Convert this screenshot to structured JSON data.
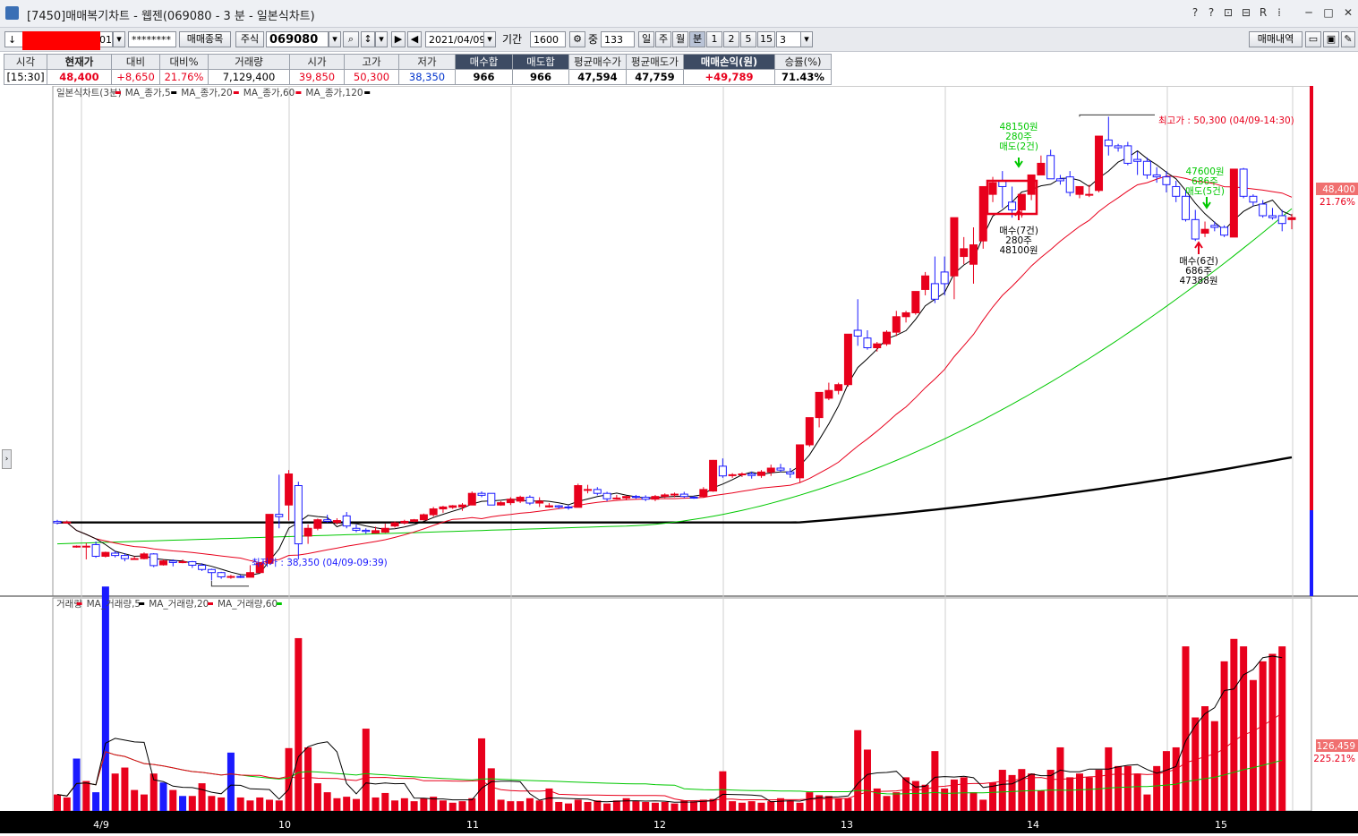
{
  "window": {
    "title": "[7450]매매복기차트 - 웹젠(069080 - 3 분 - 일본식차트)",
    "controls": [
      "?",
      "?",
      "⊡",
      "⊟",
      "R",
      "⁞",
      "─",
      "□",
      "✕"
    ]
  },
  "toolbar": {
    "account_prefix": "↓",
    "account_suffix": "01",
    "password": "********",
    "trade_item_label": "매매종목",
    "market_label": "주식",
    "code": "069080",
    "date": "2021/04/09",
    "period_label": "기간",
    "period_value": "1600",
    "count_label": "중",
    "count_value": "133",
    "interval_buttons": [
      "일",
      "주",
      "월",
      "분",
      "1",
      "2",
      "5",
      "15"
    ],
    "selected_interval": "분",
    "minute_value": "3",
    "trade_history_label": "매매내역"
  },
  "quote": {
    "headers": [
      "시각",
      "현재가",
      "대비",
      "대비%",
      "거래량",
      "시가",
      "고가",
      "저가",
      "매수합",
      "매도합",
      "평균매수가",
      "평균매도가",
      "매매손익(원)",
      "승률(%)"
    ],
    "values": [
      "[15:30]",
      "48,400",
      "+8,650",
      "21.76%",
      "7,129,400",
      "39,850",
      "50,300",
      "38,350",
      "966",
      "966",
      "47,594",
      "47,759",
      "+49,789",
      "71.43%"
    ]
  },
  "price_panel": {
    "legend": [
      {
        "label": "일본식차트(3분)",
        "color": "#e8001c"
      },
      {
        "label": "MA_종가,5",
        "color": "#000000"
      },
      {
        "label": "MA_종가,20",
        "color": "#e8001c"
      },
      {
        "label": "MA_종가,60",
        "color": "#e8001c"
      },
      {
        "label": "MA_종가,120",
        "color": "#000000"
      }
    ],
    "current_price_label": "48,400",
    "current_pct_label": "21.76%",
    "high_annotation": "최고가 : 50,300 (04/09-14:30)",
    "low_annotation": "최저가 : 38,350 (04/09-09:39)",
    "sell1": [
      "48150원",
      "280주",
      "매도(2건)"
    ],
    "buy1": [
      "매수(7건)",
      "280주",
      "48100원"
    ],
    "sell2": [
      "47600원",
      "686주",
      "매도(5건)"
    ],
    "buy2": [
      "매수(6건)",
      "686주",
      "47388원"
    ]
  },
  "volume_panel": {
    "legend": [
      {
        "label": "거래량",
        "color": "#e8001c"
      },
      {
        "label": "MA_거래량,5",
        "color": "#000000"
      },
      {
        "label": "MA_거래량,20",
        "color": "#e8001c"
      },
      {
        "label": "MA_거래량,60",
        "color": "#00c800"
      }
    ],
    "current_label": "126,459",
    "current_pct_label": "225.21%"
  },
  "x_axis": [
    "4/9",
    "10",
    "11",
    "12",
    "13",
    "14",
    "15"
  ],
  "colors": {
    "up": "#e8001c",
    "down": "#1a1aff",
    "ma5": "#000000",
    "ma20": "#e8001c",
    "ma60": "#00c800",
    "ma120": "#000000"
  },
  "chart_data": {
    "type": "candlestick",
    "interval": "3분",
    "y_range": [
      38000,
      51000
    ],
    "x_ticks": [
      "4/9",
      "10",
      "11",
      "12",
      "13",
      "14",
      "15"
    ],
    "candles": [
      [
        39880,
        39920,
        39800,
        39840
      ],
      [
        39840,
        39900,
        39820,
        39860
      ],
      [
        39240,
        39260,
        39200,
        39240
      ],
      [
        39240,
        39320,
        38900,
        39240
      ],
      [
        39280,
        39360,
        38940,
        38980
      ],
      [
        38980,
        39100,
        38950,
        39080
      ],
      [
        39060,
        39120,
        38950,
        39000
      ],
      [
        39000,
        39060,
        38850,
        38920
      ],
      [
        38920,
        38980,
        38900,
        38920
      ],
      [
        38920,
        39080,
        38900,
        39040
      ],
      [
        39040,
        39060,
        38700,
        38740
      ],
      [
        38760,
        38900,
        38740,
        38860
      ],
      [
        38860,
        38900,
        38720,
        38820
      ],
      [
        38820,
        38900,
        38800,
        38840
      ],
      [
        38840,
        38860,
        38680,
        38750
      ],
      [
        38750,
        38800,
        38600,
        38640
      ],
      [
        38640,
        38660,
        38360,
        38560
      ],
      [
        38560,
        38580,
        38400,
        38450
      ],
      [
        38450,
        38500,
        38400,
        38460
      ],
      [
        38460,
        38500,
        38420,
        38440
      ],
      [
        38440,
        38750,
        38440,
        38560
      ],
      [
        38560,
        38820,
        38550,
        38800
      ],
      [
        38800,
        40060,
        38780,
        40060
      ],
      [
        40060,
        41080,
        39700,
        40000
      ],
      [
        40300,
        41200,
        39900,
        41100
      ],
      [
        40800,
        40900,
        38900,
        39300
      ],
      [
        39500,
        39800,
        39300,
        39700
      ],
      [
        39700,
        39950,
        39650,
        39920
      ],
      [
        39920,
        40050,
        39850,
        39880
      ],
      [
        39850,
        39960,
        39800,
        39900
      ],
      [
        40020,
        40120,
        39700,
        39760
      ],
      [
        39700,
        39800,
        39600,
        39650
      ],
      [
        39650,
        39700,
        39560,
        39620
      ],
      [
        39580,
        39740,
        39560,
        39640
      ],
      [
        39600,
        39820,
        39580,
        39700
      ],
      [
        39760,
        39880,
        39720,
        39840
      ],
      [
        39840,
        39920,
        39800,
        39880
      ],
      [
        39880,
        39940,
        39860,
        39920
      ],
      [
        39920,
        40080,
        39900,
        40050
      ],
      [
        40050,
        40250,
        40000,
        40200
      ],
      [
        40200,
        40280,
        40100,
        40250
      ],
      [
        40240,
        40300,
        40200,
        40280
      ],
      [
        40250,
        40350,
        40150,
        40300
      ],
      [
        40300,
        40650,
        40300,
        40600
      ],
      [
        40600,
        40650,
        40500,
        40550
      ],
      [
        40600,
        40580,
        40300,
        40300
      ],
      [
        40300,
        40400,
        40280,
        40360
      ],
      [
        40360,
        40500,
        40300,
        40450
      ],
      [
        40400,
        40540,
        40350,
        40500
      ],
      [
        40500,
        40550,
        40300,
        40350
      ],
      [
        40350,
        40500,
        40250,
        40400
      ],
      [
        40250,
        40350,
        40230,
        40280
      ],
      [
        40280,
        40300,
        40200,
        40250
      ],
      [
        40250,
        40300,
        40180,
        40240
      ],
      [
        40240,
        40850,
        40240,
        40800
      ],
      [
        40680,
        40820,
        40600,
        40700
      ],
      [
        40700,
        40760,
        40550,
        40600
      ],
      [
        40600,
        40640,
        40400,
        40460
      ],
      [
        40460,
        40560,
        40440,
        40480
      ],
      [
        40480,
        40540,
        40420,
        40520
      ],
      [
        40520,
        40560,
        40460,
        40500
      ],
      [
        40500,
        40550,
        40400,
        40450
      ],
      [
        40450,
        40560,
        40400,
        40520
      ],
      [
        40520,
        40600,
        40480,
        40560
      ],
      [
        40560,
        40620,
        40500,
        40580
      ],
      [
        40580,
        40640,
        40480,
        40520
      ],
      [
        40500,
        40540,
        40460,
        40480
      ],
      [
        40520,
        40760,
        40500,
        40700
      ],
      [
        40660,
        41460,
        40640,
        41450
      ],
      [
        41300,
        41500,
        41000,
        41050
      ],
      [
        41060,
        41120,
        41000,
        41080
      ],
      [
        41080,
        41140,
        41020,
        41100
      ],
      [
        41100,
        41160,
        40980,
        41060
      ],
      [
        41060,
        41200,
        41000,
        41150
      ],
      [
        41150,
        41340,
        41050,
        41250
      ],
      [
        41250,
        41360,
        41150,
        41200
      ],
      [
        41150,
        41250,
        41000,
        41100
      ],
      [
        41000,
        41850,
        40880,
        41850
      ],
      [
        41850,
        42550,
        41800,
        42550
      ],
      [
        42550,
        43200,
        42300,
        43200
      ],
      [
        43050,
        43450,
        43000,
        43250
      ],
      [
        43250,
        43450,
        43150,
        43400
      ],
      [
        43400,
        44700,
        43350,
        44700
      ],
      [
        44800,
        45600,
        44400,
        44650
      ],
      [
        44600,
        44800,
        44300,
        44350
      ],
      [
        44350,
        44500,
        44250,
        44450
      ],
      [
        44450,
        44800,
        44400,
        44750
      ],
      [
        44750,
        45300,
        44650,
        45150
      ],
      [
        45150,
        45300,
        45000,
        45250
      ],
      [
        45250,
        45800,
        45200,
        45800
      ],
      [
        45850,
        46300,
        45700,
        46200
      ],
      [
        46000,
        46700,
        45500,
        45600
      ],
      [
        46300,
        46700,
        45700,
        46000
      ],
      [
        46200,
        47700,
        45600,
        47700
      ],
      [
        46700,
        47200,
        46500,
        46900
      ],
      [
        46500,
        47450,
        46000,
        47000
      ],
      [
        47100,
        48500,
        46900,
        48500
      ],
      [
        48300,
        48750,
        48100,
        48600
      ],
      [
        48650,
        48900,
        47950,
        48500
      ],
      [
        48100,
        48500,
        47700,
        47900
      ],
      [
        47900,
        48300,
        47700,
        48300
      ],
      [
        48300,
        48800,
        48150,
        48800
      ],
      [
        48800,
        49300,
        48900,
        49100
      ],
      [
        49300,
        49450,
        48700,
        48700
      ],
      [
        48700,
        48800,
        48550,
        48650
      ],
      [
        48750,
        48900,
        48250,
        48350
      ],
      [
        48300,
        48500,
        48200,
        48500
      ],
      [
        48300,
        48550,
        48230,
        48300
      ],
      [
        48400,
        49800,
        48350,
        49800
      ],
      [
        49700,
        50300,
        49300,
        49550
      ],
      [
        49550,
        49600,
        49400,
        49500
      ],
      [
        49550,
        49650,
        49050,
        49100
      ],
      [
        49200,
        49400,
        48800,
        49150
      ],
      [
        49150,
        49250,
        48700,
        48800
      ],
      [
        48800,
        49000,
        48600,
        48750
      ],
      [
        48750,
        48900,
        48350,
        48550
      ],
      [
        48500,
        48650,
        48100,
        48250
      ],
      [
        48250,
        48400,
        47600,
        47650
      ],
      [
        47650,
        47900,
        47100,
        47150
      ],
      [
        47300,
        47600,
        47200,
        47400
      ],
      [
        47500,
        47600,
        47350,
        47450
      ],
      [
        47450,
        47500,
        47200,
        47250
      ],
      [
        47200,
        48950,
        47200,
        48950
      ],
      [
        48950,
        48980,
        48200,
        48250
      ],
      [
        48250,
        48300,
        48000,
        48100
      ],
      [
        48050,
        48150,
        47700,
        47750
      ],
      [
        47750,
        47950,
        47650,
        47700
      ],
      [
        47750,
        47900,
        47350,
        47550
      ],
      [
        47650,
        47800,
        47400,
        47700
      ]
    ],
    "volume_y_range": [
      0,
      280000
    ],
    "volume": [
      [
        2200,
        1
      ],
      [
        1800,
        1
      ],
      [
        7000,
        0
      ],
      [
        4000,
        1
      ],
      [
        2500,
        0
      ],
      [
        30000,
        0
      ],
      [
        5000,
        1
      ],
      [
        5800,
        1
      ],
      [
        2800,
        1
      ],
      [
        2200,
        1
      ],
      [
        5000,
        1
      ],
      [
        3800,
        0
      ],
      [
        2800,
        1
      ],
      [
        2000,
        0
      ],
      [
        2000,
        1
      ],
      [
        3700,
        1
      ],
      [
        2000,
        1
      ],
      [
        1800,
        1
      ],
      [
        7800,
        0
      ],
      [
        1800,
        1
      ],
      [
        1400,
        1
      ],
      [
        1800,
        1
      ],
      [
        1500,
        1
      ],
      [
        1400,
        1
      ],
      [
        8400,
        1
      ],
      [
        23100,
        1
      ],
      [
        8500,
        1
      ],
      [
        3700,
        1
      ],
      [
        2500,
        1
      ],
      [
        1700,
        1
      ],
      [
        1900,
        1
      ],
      [
        1600,
        1
      ],
      [
        11000,
        1
      ],
      [
        1800,
        1
      ],
      [
        2400,
        1
      ],
      [
        1400,
        1
      ],
      [
        1700,
        1
      ],
      [
        1300,
        1
      ],
      [
        1700,
        1
      ],
      [
        1900,
        1
      ],
      [
        1400,
        1
      ],
      [
        1100,
        1
      ],
      [
        1300,
        1
      ],
      [
        1700,
        1
      ],
      [
        9700,
        1
      ],
      [
        5700,
        1
      ],
      [
        1500,
        1
      ],
      [
        1300,
        1
      ],
      [
        1300,
        1
      ],
      [
        1700,
        1
      ],
      [
        1400,
        1
      ],
      [
        3000,
        1
      ],
      [
        1200,
        1
      ],
      [
        1000,
        1
      ],
      [
        1500,
        1
      ],
      [
        1200,
        1
      ],
      [
        1400,
        1
      ],
      [
        1000,
        1
      ],
      [
        1400,
        1
      ],
      [
        1700,
        1
      ],
      [
        1300,
        1
      ],
      [
        1200,
        1
      ],
      [
        1100,
        1
      ],
      [
        1200,
        1
      ],
      [
        1000,
        1
      ],
      [
        1400,
        1
      ],
      [
        1300,
        1
      ],
      [
        1500,
        1
      ],
      [
        1600,
        1
      ],
      [
        5300,
        1
      ],
      [
        1300,
        1
      ],
      [
        1100,
        1
      ],
      [
        1300,
        1
      ],
      [
        1100,
        1
      ],
      [
        1300,
        1
      ],
      [
        1700,
        1
      ],
      [
        1400,
        1
      ],
      [
        1100,
        1
      ],
      [
        2500,
        1
      ],
      [
        2100,
        1
      ],
      [
        2000,
        1
      ],
      [
        1700,
        1
      ],
      [
        1700,
        1
      ],
      [
        10800,
        1
      ],
      [
        8200,
        1
      ],
      [
        3000,
        1
      ],
      [
        2000,
        1
      ],
      [
        2500,
        1
      ],
      [
        4500,
        1
      ],
      [
        4000,
        1
      ],
      [
        3500,
        1
      ],
      [
        8000,
        1
      ],
      [
        3000,
        1
      ],
      [
        4200,
        1
      ],
      [
        4500,
        1
      ],
      [
        2500,
        1
      ],
      [
        1500,
        1
      ],
      [
        3800,
        1
      ],
      [
        5500,
        1
      ],
      [
        4800,
        1
      ],
      [
        5600,
        1
      ],
      [
        5000,
        1
      ],
      [
        2700,
        1
      ],
      [
        5500,
        1
      ],
      [
        8500,
        1
      ],
      [
        4500,
        1
      ],
      [
        5000,
        1
      ],
      [
        4500,
        1
      ],
      [
        5500,
        1
      ],
      [
        8500,
        1
      ],
      [
        6000,
        1
      ],
      [
        6000,
        1
      ],
      [
        5000,
        1
      ],
      [
        2200,
        1
      ],
      [
        6000,
        1
      ],
      [
        8000,
        1
      ],
      [
        8500,
        1
      ],
      [
        22000,
        1
      ],
      [
        12500,
        1
      ],
      [
        14000,
        1
      ],
      [
        12000,
        1
      ],
      [
        20000,
        1
      ],
      [
        23000,
        1
      ],
      [
        22000,
        1
      ],
      [
        17500,
        1
      ],
      [
        20000,
        1
      ],
      [
        21000,
        1
      ],
      [
        22000,
        1
      ]
    ]
  }
}
